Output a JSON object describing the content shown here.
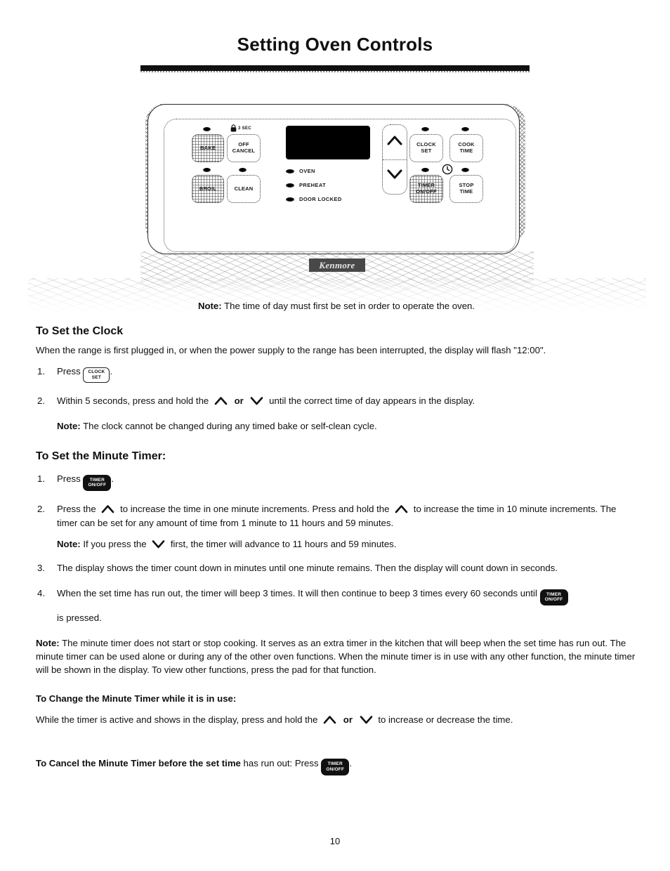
{
  "page": {
    "title": "Setting Oven Controls",
    "number": "10"
  },
  "control_panel": {
    "left_pads": [
      {
        "line1": "BAKE",
        "line2": "",
        "textured": true
      },
      {
        "line1": "OFF",
        "line2": "CANCEL",
        "textured": false
      },
      {
        "line1": "BROIL",
        "line2": "",
        "textured": true
      },
      {
        "line1": "CLEAN",
        "line2": "",
        "textured": false
      }
    ],
    "lock_label": "3 SEC",
    "lock_icon": "padlock-icon",
    "indicators": [
      {
        "label": "OVEN"
      },
      {
        "label": "PREHEAT"
      },
      {
        "label": "DOOR LOCKED"
      }
    ],
    "arrow_pad": {
      "up_icon": "chevron-up-icon",
      "down_icon": "chevron-down-icon"
    },
    "right_pads": [
      {
        "line1": "CLOCK",
        "line2": "SET",
        "textured": false
      },
      {
        "line1": "COOK",
        "line2": "TIME",
        "textured": false
      },
      {
        "line1": "TIMER",
        "line2": "ON/OFF",
        "textured": true
      },
      {
        "line1": "STOP",
        "line2": "TIME",
        "textured": false
      }
    ],
    "clock_icon": "clock-icon",
    "display_window": "",
    "brand": "Kenmore"
  },
  "content": {
    "lead_note_label": "Note:",
    "lead_note_text": " The time of day must first be set in order to operate the oven.",
    "clock_section": {
      "heading": "To Set the Clock",
      "intro": "When the range is first plugged in, or when the power supply to the range has been interrupted, the display will flash \"12:00\".",
      "step1": {
        "num": "1.",
        "press": "Press",
        "key_l1": "CLOCK",
        "key_l2": "SET",
        "tail": "."
      },
      "step2": {
        "num": "2.",
        "before": "Within 5 seconds, press and hold the",
        "or": "or",
        "after": "until the correct time of day appears in the display."
      },
      "note_label": "Note:",
      "note_text": " The clock cannot be changed during any timed bake or self-clean cycle."
    },
    "timer_section": {
      "heading": "To Set the Minute Timer:",
      "step1": {
        "num": "1.",
        "press": "Press",
        "key_l1": "TIMER",
        "key_l2": "ON/OFF",
        "tail": "."
      },
      "step2": {
        "num": "2.",
        "part1": "Press the",
        "part2": "to increase the time in one minute increments. Press and hold the",
        "part3": "to increase the time in 10 minute increments. The timer can be set for any amount of time from 1 minute to 11 hours and 59 minutes."
      },
      "step2_note_label": "Note:",
      "step2_note_before": " If you press the",
      "step2_note_after": "first, the timer will advance to 11 hours and 59 minutes.",
      "step3": {
        "num": "3.",
        "text": "The display shows the timer count down in minutes until one minute remains. Then the display will count down in seconds."
      },
      "step4": {
        "num": "4.",
        "before": "When the set time has run out, the timer will beep 3 times. It will then continue to beep 3 times every 60 seconds until",
        "key_l1": "TIMER",
        "key_l2": "ON/OFF",
        "after": "is pressed."
      },
      "big_note_label": "Note:",
      "big_note_text": " The minute timer does not start or stop cooking. It serves as an extra timer in the kitchen that will beep when the set time has run out. The minute timer can be used alone or during any of the other oven functions. When the minute timer is in use with any other function, the minute timer will be shown in the display. To view other functions, press the pad for that function."
    },
    "change_section": {
      "heading": "To Change the Minute Timer while it is in use:",
      "before": "While the timer is active and shows in the display, press and hold the",
      "or": "or",
      "after": "to increase or decrease the time."
    },
    "cancel_section": {
      "heading_bold": "To Cancel the Minute Timer before the set time",
      "heading_rest": " has run out: Press",
      "key_l1": "TIMER",
      "key_l2": "ON/OFF",
      "tail": "."
    }
  }
}
